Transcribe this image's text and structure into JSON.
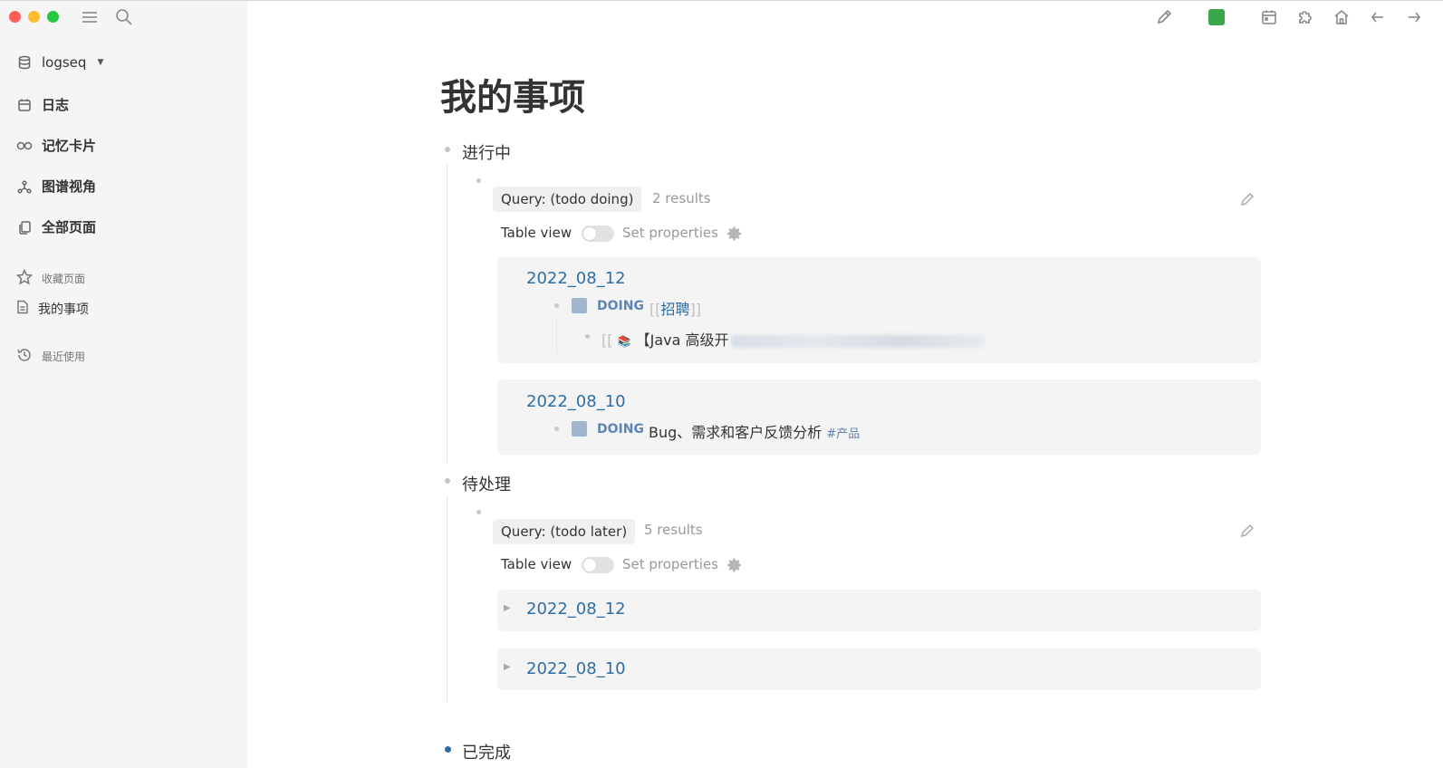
{
  "sidebar": {
    "graph_name": "logseq",
    "nav": [
      {
        "label": "日志",
        "icon": "calendar-icon"
      },
      {
        "label": "记忆卡片",
        "icon": "infinity-icon"
      },
      {
        "label": "图谱视角",
        "icon": "graph-icon"
      },
      {
        "label": "全部页面",
        "icon": "pages-icon"
      }
    ],
    "favorites_label": "收藏页面",
    "favorites": [
      {
        "label": "我的事项"
      }
    ],
    "recent_label": "最近使用"
  },
  "page": {
    "title": "我的事项",
    "sections": [
      {
        "label": "进行中",
        "query": "Query: (todo doing)",
        "results": "2 results",
        "table_view_label": "Table view",
        "set_properties_label": "Set properties",
        "groups": [
          {
            "date": "2022_08_12",
            "marker": "DOING",
            "ref_open": "[[",
            "ref": "招聘",
            "ref_close": "]]",
            "child_prefix": "[[",
            "child_text": "【Java 高级开"
          },
          {
            "date": "2022_08_10",
            "marker": "DOING",
            "text": "Bug、需求和客户反馈分析",
            "tag": "#产品"
          }
        ]
      },
      {
        "label": "待处理",
        "query": "Query: (todo later)",
        "results": "5 results",
        "table_view_label": "Table view",
        "set_properties_label": "Set properties",
        "groups": [
          {
            "date": "2022_08_12"
          },
          {
            "date": "2022_08_10"
          }
        ]
      },
      {
        "label": "已完成"
      }
    ]
  }
}
